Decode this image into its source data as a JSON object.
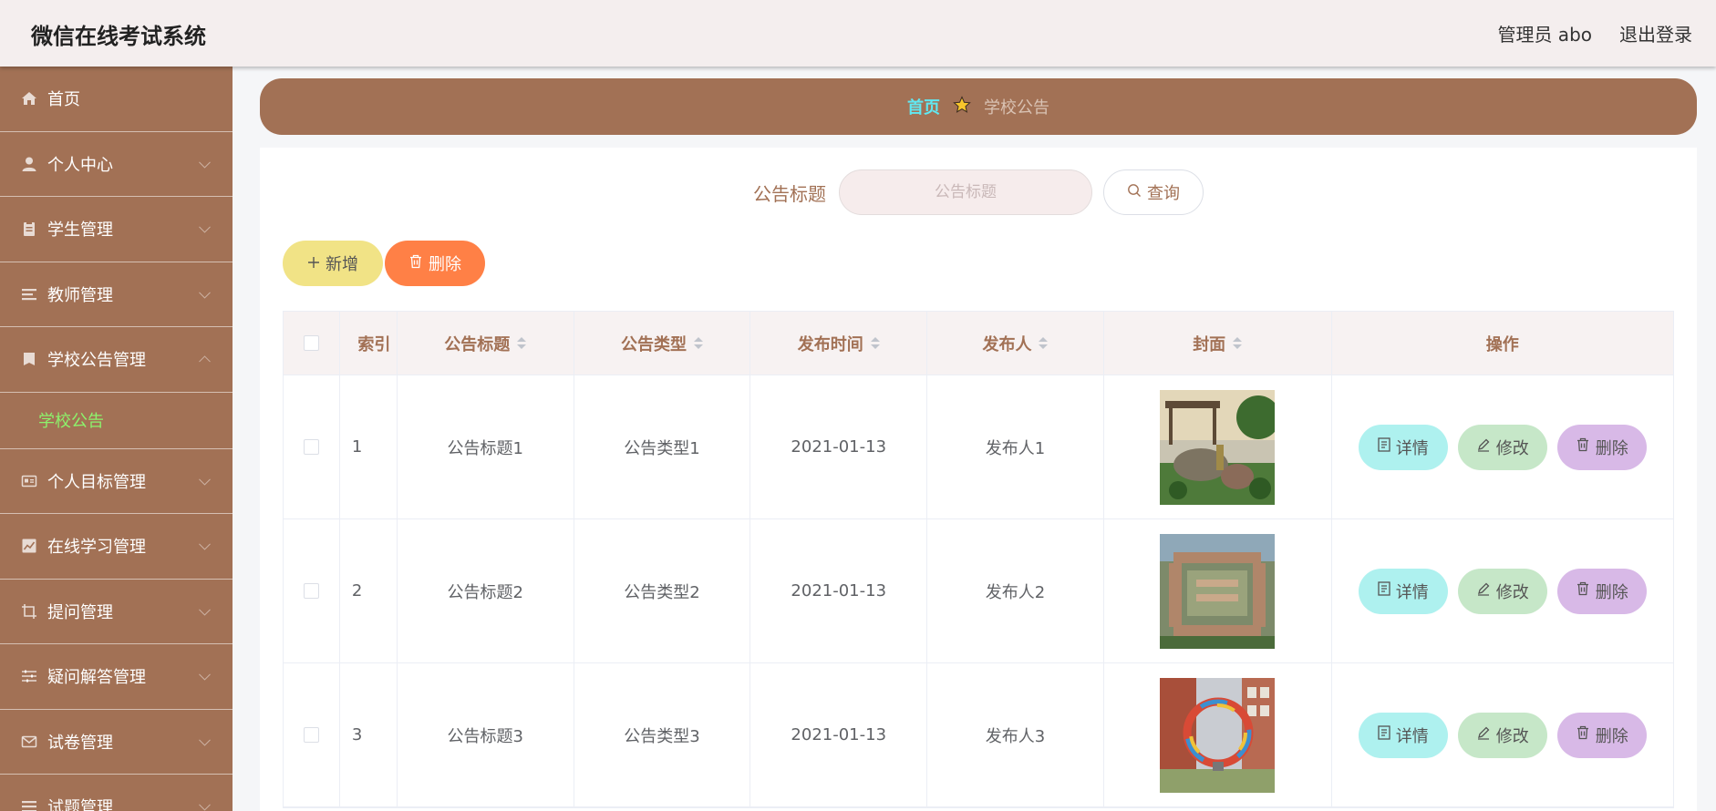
{
  "header": {
    "title": "微信在线考试系统",
    "user": "管理员 abo",
    "logout": "退出登录"
  },
  "sidebar": {
    "items": [
      {
        "label": "首页",
        "icon": "home-icon"
      },
      {
        "label": "个人中心",
        "icon": "user-icon"
      },
      {
        "label": "学生管理",
        "icon": "clipboard-icon"
      },
      {
        "label": "教师管理",
        "icon": "list-icon"
      },
      {
        "label": "学校公告管理",
        "icon": "notebook-icon",
        "expanded": true,
        "sub": [
          "学校公告"
        ]
      },
      {
        "label": "个人目标管理",
        "icon": "id-card-icon"
      },
      {
        "label": "在线学习管理",
        "icon": "chart-icon"
      },
      {
        "label": "提问管理",
        "icon": "crop-icon"
      },
      {
        "label": "疑问解答管理",
        "icon": "sliders-icon"
      },
      {
        "label": "试卷管理",
        "icon": "mail-icon"
      },
      {
        "label": "试题管理",
        "icon": "list-icon"
      }
    ]
  },
  "breadcrumb": {
    "home": "首页",
    "current": "学校公告"
  },
  "search": {
    "label": "公告标题",
    "placeholder": "公告标题",
    "query": "查询"
  },
  "actions": {
    "add": "新增",
    "delete": "删除"
  },
  "table": {
    "headers": {
      "index": "索引",
      "title": "公告标题",
      "type": "公告类型",
      "time": "发布时间",
      "publisher": "发布人",
      "cover": "封面",
      "ops": "操作"
    },
    "rows": [
      {
        "index": "1",
        "title": "公告标题1",
        "type": "公告类型1",
        "time": "2021-01-13",
        "publisher": "发布人1"
      },
      {
        "index": "2",
        "title": "公告标题2",
        "type": "公告类型2",
        "time": "2021-01-13",
        "publisher": "发布人2"
      },
      {
        "index": "3",
        "title": "公告标题3",
        "type": "公告类型3",
        "time": "2021-01-13",
        "publisher": "发布人3"
      }
    ],
    "ops": {
      "detail": "详情",
      "edit": "修改",
      "delete": "删除"
    }
  },
  "colors": {
    "brand": "#a27155",
    "header_bg": "#f4eeee",
    "accent_home": "#60e8f2",
    "active_sub": "#8cf36c",
    "add_btn": "#f1e386",
    "delete_btn": "#ff8046",
    "detail_btn": "#aef1ef",
    "edit_btn": "#c6e7c8",
    "row_delete_btn": "#d8b9e7"
  }
}
